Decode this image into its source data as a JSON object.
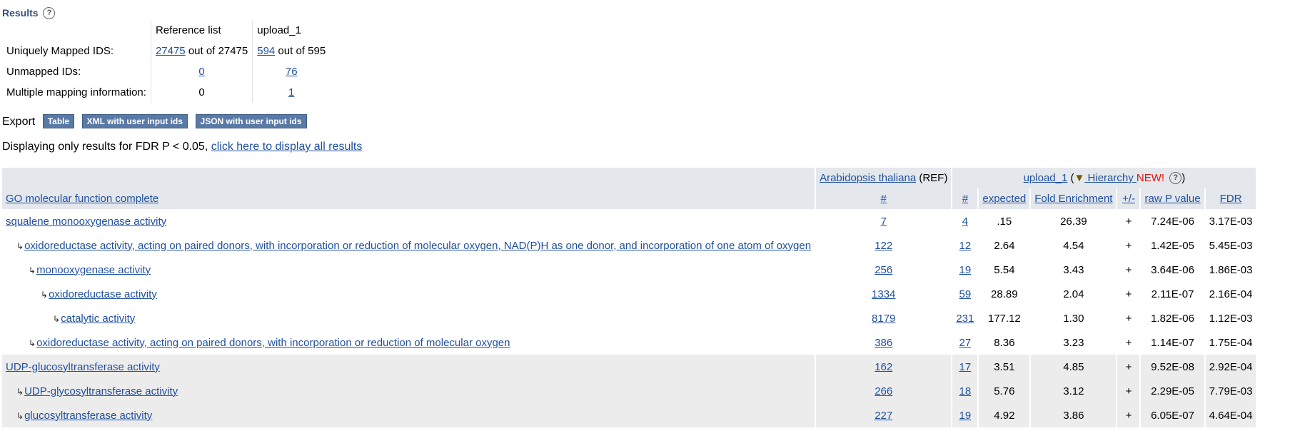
{
  "results": {
    "title": "Results",
    "help": "?"
  },
  "mapping": {
    "col_ref": "Reference list",
    "col_upload": "upload_1",
    "rows": [
      {
        "label": "Uniquely Mapped IDS:",
        "ref_link": "27475",
        "ref_rest": " out of 27475",
        "up_link": "594",
        "up_rest": " out of 595"
      },
      {
        "label": "Unmapped IDs:",
        "ref_link": "0",
        "up_link": "76"
      },
      {
        "label": "Multiple mapping information:",
        "ref_value": "0",
        "up_link": "1"
      }
    ]
  },
  "export": {
    "label": "Export",
    "table_btn": "Table",
    "xml_btn": "XML with user input ids",
    "json_btn": "JSON with user input ids"
  },
  "filter": {
    "text": "Displaying only results for FDR P < 0.05, ",
    "link": "click here to display all results"
  },
  "table": {
    "species": "Arabidopsis thaliana",
    "ref_tag": " (REF)",
    "upload_label": "upload_1",
    "hierarchy_label": " Hierarchy ",
    "new_label": "NEW!",
    "go_header": "GO molecular function complete",
    "col_ref_count": "#",
    "col_count": "#",
    "col_expected": "expected",
    "col_fold": "Fold Enrichment",
    "col_dir": "+/-",
    "col_raw_p": "raw P value",
    "col_fdr": "FDR",
    "rows": [
      {
        "term": "squalene monooxygenase activity",
        "ref": "7",
        "count": "4",
        "expected": ".15",
        "fold": "26.39",
        "dir": "+",
        "raw_p": "7.24E-06",
        "fdr": "3.17E-03"
      },
      {
        "term": "oxidoreductase activity, acting on paired donors, with incorporation or reduction of molecular oxygen, NAD(P)H as one donor, and incorporation of one atom of oxygen",
        "ref": "122",
        "count": "12",
        "expected": "2.64",
        "fold": "4.54",
        "dir": "+",
        "raw_p": "1.42E-05",
        "fdr": "5.45E-03"
      },
      {
        "term": "monooxygenase activity",
        "ref": "256",
        "count": "19",
        "expected": "5.54",
        "fold": "3.43",
        "dir": "+",
        "raw_p": "3.64E-06",
        "fdr": "1.86E-03"
      },
      {
        "term": "oxidoreductase activity",
        "ref": "1334",
        "count": "59",
        "expected": "28.89",
        "fold": "2.04",
        "dir": "+",
        "raw_p": "2.11E-07",
        "fdr": "2.16E-04"
      },
      {
        "term": "catalytic activity",
        "ref": "8179",
        "count": "231",
        "expected": "177.12",
        "fold": "1.30",
        "dir": "+",
        "raw_p": "1.82E-06",
        "fdr": "1.12E-03"
      },
      {
        "term": "oxidoreductase activity, acting on paired donors, with incorporation or reduction of molecular oxygen",
        "ref": "386",
        "count": "27",
        "expected": "8.36",
        "fold": "3.23",
        "dir": "+",
        "raw_p": "1.14E-07",
        "fdr": "1.75E-04"
      },
      {
        "term": "UDP-glucosyltransferase activity",
        "ref": "162",
        "count": "17",
        "expected": "3.51",
        "fold": "4.85",
        "dir": "+",
        "raw_p": "9.52E-08",
        "fdr": "2.92E-04"
      },
      {
        "term": "UDP-glycosyltransferase activity",
        "ref": "266",
        "count": "18",
        "expected": "5.76",
        "fold": "3.12",
        "dir": "+",
        "raw_p": "2.29E-05",
        "fdr": "7.79E-03"
      },
      {
        "term": "glucosyltransferase activity",
        "ref": "227",
        "count": "19",
        "expected": "4.92",
        "fold": "3.86",
        "dir": "+",
        "raw_p": "6.05E-07",
        "fdr": "4.64E-04"
      }
    ]
  }
}
